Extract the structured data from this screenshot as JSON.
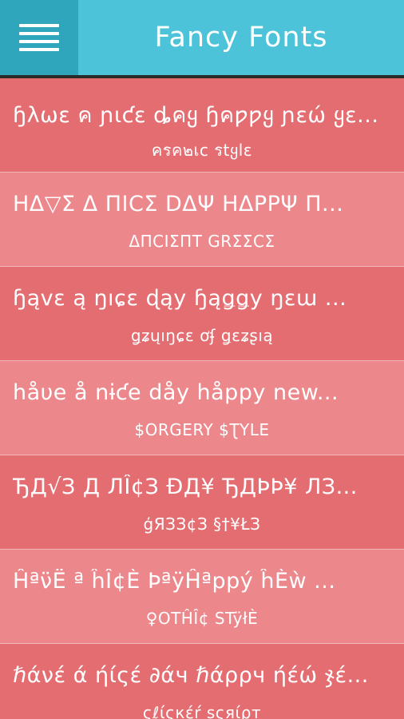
{
  "header": {
    "title": "Fancy Fonts",
    "menu_icon": "hamburger-menu-icon"
  },
  "styles": [
    {
      "sample": "ɧλωɛ ค ɲιƈɛ ȡคყ ɧคƿƿყ ɲɛώ ყɛ...",
      "name": "ครค๒เc รtყlɛ"
    },
    {
      "sample": "ΗΔ▽Σ Δ ΠΙϹΣ DΔΨ ΗΔΡΡΨ Π...",
      "name": "ΔΠϹΙΣΠΤ GRΣΣϹΣ"
    },
    {
      "sample": "ɧąvɛ ą ŋıɕɛ ɖąy ɧąǥǥy ŋɛա ...",
      "name": "ǥʑųıŋɕɛ ơʄ ǥɛʑʂıą"
    },
    {
      "sample": "håυe å nɨƈe dåy håppy new...",
      "name": "$ORGERY $ƮYLE"
    },
    {
      "sample": "ЂД√З Д ЛÎ¢З ÐД¥ ЂДÞÞ¥ ЛЗ...",
      "name": "ģЯЗЗ¢З §†¥ŁЗ"
    },
    {
      "sample": "Ĥªν̈Ё ª ĥÎ¢È ÞªÿĤªppý ĥÈẁ ...",
      "name": "♀ОТĤÎ¢ STÿłÈ"
    },
    {
      "sample": "ℏάνέ ά ήίςέ ∂άч ℏάρρч ήέώ ჯέ...",
      "name": "ςℓίςкέŕ ѕςяίρт"
    }
  ]
}
